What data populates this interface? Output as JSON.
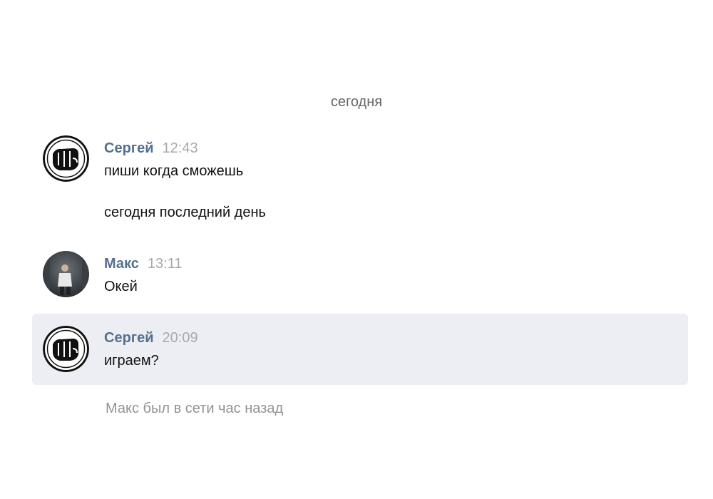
{
  "date_divider": "сегодня",
  "messages": [
    {
      "author": "Сергей",
      "time": "12:43",
      "lines": [
        "пиши когда сможешь",
        "сегодня последний день"
      ],
      "avatar_icon": "fist-logo-icon"
    },
    {
      "author": "Макс",
      "time": "13:11",
      "lines": [
        "Окей"
      ],
      "avatar_icon": "user-photo"
    },
    {
      "author": "Сергей",
      "time": "20:09",
      "lines": [
        "играем?"
      ],
      "avatar_icon": "fist-logo-icon",
      "highlighted": true
    }
  ],
  "status": "Макс был в сети час назад",
  "colors": {
    "author": "#55708f",
    "time": "#a7a9ac",
    "highlight_bg": "#edeef3",
    "status": "#939393"
  }
}
